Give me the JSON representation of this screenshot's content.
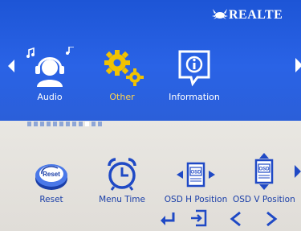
{
  "brand": {
    "text": "REALTE",
    "logo_icon": "crab-logo-icon"
  },
  "top_menu": {
    "items": [
      {
        "label": "Audio",
        "icon": "headphones-music-icon",
        "selected": false
      },
      {
        "label": "Other",
        "icon": "gears-icon",
        "selected": true
      },
      {
        "label": "Information",
        "icon": "info-icon",
        "selected": false
      }
    ]
  },
  "page_indicator": {
    "total": 12,
    "active_index": 9
  },
  "bottom_menu": {
    "items": [
      {
        "label": "Reset",
        "icon": "reset-icon"
      },
      {
        "label": "Menu Time",
        "icon": "alarm-clock-icon"
      },
      {
        "label": "OSD H Position",
        "icon": "osd-h-position-icon"
      },
      {
        "label": "OSD V Position",
        "icon": "osd-v-position-icon"
      }
    ]
  },
  "nav_buttons": [
    "enter-icon",
    "exit-icon",
    "left-arrow-icon",
    "right-arrow-icon"
  ],
  "colors": {
    "top_bg": "#2a63e6",
    "bottom_bg": "#e4e1dc",
    "label_blue": "#1a3ea8",
    "selected_yellow": "#ffd34d",
    "accent_blue": "#1f49c5"
  }
}
